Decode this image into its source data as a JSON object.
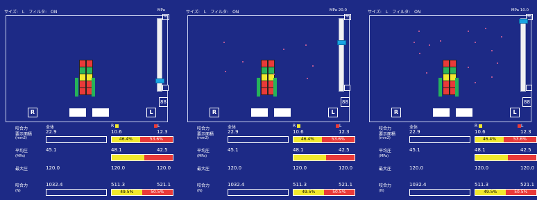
{
  "header": {
    "size_label": "サイズ:",
    "size_value": "L",
    "filter_label": "フィルタ:",
    "filter_value": "ON"
  },
  "panels": [
    {
      "mpa": "MPa",
      "slider_level": 0.9,
      "spots": []
    },
    {
      "mpa": "MPa 20.0",
      "slider_level": 0.32,
      "spots": [
        [
          60,
          60
        ],
        [
          87,
          88
        ],
        [
          146,
          70
        ],
        [
          132,
          106
        ],
        [
          178,
          64
        ],
        [
          188,
          94
        ],
        [
          180,
          112
        ],
        [
          62,
          102
        ]
      ]
    },
    {
      "mpa": "MPa 10.0",
      "slider_level": 0.0,
      "spots": [
        [
          79,
          44
        ],
        [
          72,
          60
        ],
        [
          80,
          76
        ],
        [
          94,
          64
        ],
        [
          90,
          104
        ],
        [
          150,
          44
        ],
        [
          160,
          60
        ],
        [
          184,
          72
        ],
        [
          192,
          90
        ],
        [
          184,
          110
        ],
        [
          160,
          118
        ],
        [
          150,
          96
        ],
        [
          198,
          52
        ],
        [
          175,
          40
        ],
        [
          110,
          58
        ]
      ]
    }
  ],
  "controls": {
    "all_label": "All",
    "scale_label": "88",
    "right_label": "R",
    "left_label": "L"
  },
  "metrics": {
    "total_label": "全体",
    "R_label": "R",
    "L_label": "L",
    "area_label1": "咬合力",
    "area_label2": "要示面積",
    "area_unit": "(mm2)",
    "area_total": "22.9",
    "area_R": "10.6",
    "area_L": "12.3",
    "area_R_pct": "46.4%",
    "area_L_pct": "53.6%",
    "avg_label": "平均圧",
    "avg_unit": "(MPa)",
    "avg_total": "45.1",
    "avg_R": "48.1",
    "avg_L": "42.5",
    "avg_R_frac": 0.53,
    "max_label": "最大圧",
    "max_total": "120.0",
    "max_R": "120.0",
    "max_L": "120.0",
    "force_label": "咬合力",
    "force_unit": "(N)",
    "force_total": "1032.4",
    "force_R": "511.3",
    "force_L": "521.1",
    "force_R_pct": "49.5%",
    "force_L_pct": "50.5%"
  },
  "colors": {
    "bg": "#1d2a86",
    "yellow": "#f2e92e",
    "red": "#e93a39",
    "spot": "#e4679b",
    "slider_knob": "#19a4e3"
  },
  "icons": [
    "teeth-icon",
    "bite-tool-icon"
  ]
}
